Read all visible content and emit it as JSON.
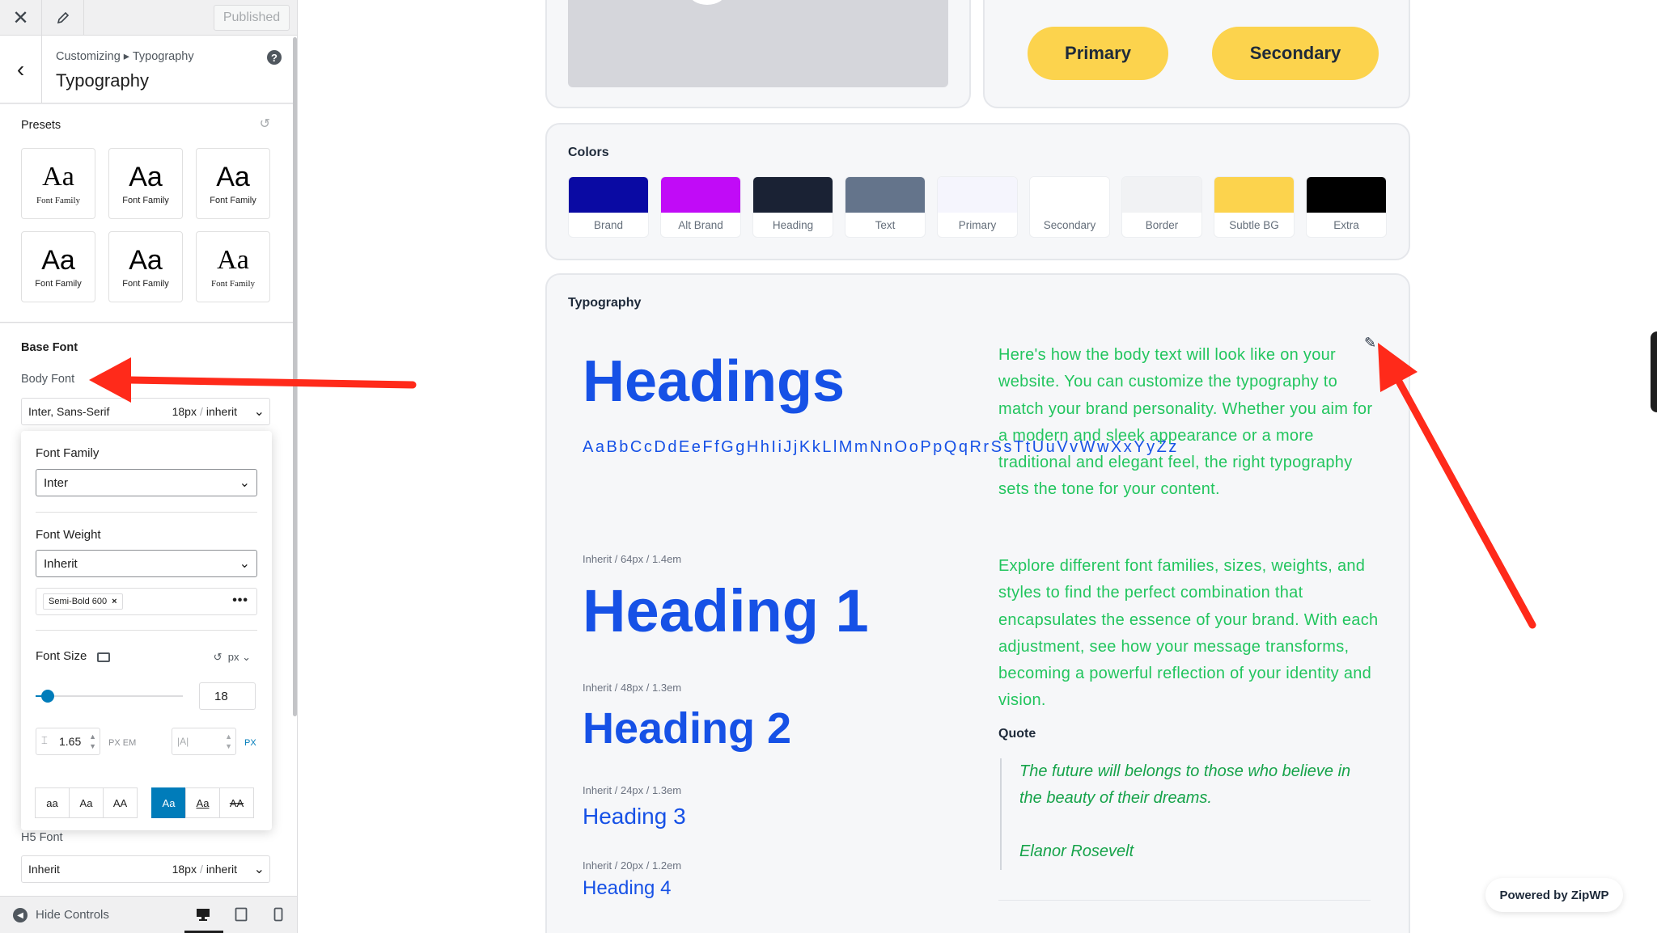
{
  "topbar": {
    "close_icon": "close-icon",
    "edit_icon": "pencil-icon",
    "published_label": "Published"
  },
  "section": {
    "breadcrumb": "Customizing ▸ Typography",
    "title": "Typography",
    "help_icon": "help-icon"
  },
  "presets": {
    "label": "Presets",
    "items": [
      {
        "aa": "Aa",
        "label": "Font Family"
      },
      {
        "aa": "Aa",
        "label": "Font Family"
      },
      {
        "aa": "Aa",
        "label": "Font Family"
      },
      {
        "aa": "Aa",
        "label": "Font Family"
      },
      {
        "aa": "Aa",
        "label": "Font Family"
      },
      {
        "aa": "Aa",
        "label": "Font Family"
      }
    ]
  },
  "base_font": {
    "label": "Base Font",
    "body_font_label": "Body Font",
    "body_font": {
      "family": "Inter, Sans-Serif",
      "size": "18px",
      "separator": "/",
      "line": "inherit"
    },
    "h5_label": "H5 Font",
    "h5_font": {
      "family": "Inherit",
      "size": "18px",
      "separator": "/",
      "line": "inherit"
    }
  },
  "popover": {
    "family_label": "Font Family",
    "family_value": "Inter",
    "weight_label": "Font Weight",
    "weight_value": "Inherit",
    "variant_token": "Semi-Bold 600",
    "token_remove": "×",
    "more": "•••",
    "size_label": "Font Size",
    "size_unit": "px",
    "size_value": "18",
    "size_slider_fraction": 0.08,
    "line_height_value": "1.65",
    "line_height_units": "PX EM",
    "letter_spacing_placeholder": "|A|",
    "letter_spacing_unit": "PX",
    "case_buttons": [
      "aa",
      "Aa",
      "AA",
      "Aa",
      "Aa",
      "AA"
    ]
  },
  "bottombar": {
    "hide_label": "Hide Controls"
  },
  "preview": {
    "buttons": {
      "primary": "Primary",
      "secondary": "Secondary"
    },
    "colors": {
      "title": "Colors",
      "swatches": [
        {
          "name": "Brand",
          "color": "#0a0aa3"
        },
        {
          "name": "Alt Brand",
          "color": "#c10bf7"
        },
        {
          "name": "Heading",
          "color": "#1a2234"
        },
        {
          "name": "Text",
          "color": "#64748b"
        },
        {
          "name": "Primary",
          "color": "#f5f5fd"
        },
        {
          "name": "Secondary",
          "color": "#ffffff"
        },
        {
          "name": "Border",
          "color": "#f1f2f4"
        },
        {
          "name": "Subtle BG",
          "color": "#fcd34d"
        },
        {
          "name": "Extra",
          "color": "#000000"
        }
      ]
    },
    "typography": {
      "title": "Typography",
      "headings_sample": "Headings",
      "alphabet": "AaBbCcDdEeFfGgHhIiJjKkLlMmNnOoPpQqRrSsTtUuVvWwXxYyZz",
      "h1_meta": "Inherit / 64px / 1.4em",
      "h1": "Heading 1",
      "h2_meta": "Inherit / 48px / 1.3em",
      "h2": "Heading 2",
      "h3_meta": "Inherit / 24px / 1.3em",
      "h3": "Heading 3",
      "h4_meta": "Inherit / 20px / 1.2em",
      "h4": "Heading 4",
      "body1": "Here's how the body text will look like on your website. You can customize the typography to match your brand personality. Whether you aim for a modern and sleek appearance or a more traditional and elegant feel, the right typography sets the tone for your content.",
      "body2": "Explore different font families, sizes, weights, and styles to find the perfect combination that encapsulates the essence of your brand. With each adjustment, see how your message transforms, becoming a powerful reflection of your identity and vision.",
      "quote_label": "Quote",
      "quote_text": "The future will belongs to those who believe in the beauty of their dreams.",
      "quote_author": "Elanor Rosevelt"
    },
    "powered_by": "Powered by ZipWP"
  },
  "colors": {
    "accent": "#007cba",
    "heading_blue": "#1651e6",
    "body_green": "#22c55e",
    "arrow_red": "#ff2a1a"
  }
}
